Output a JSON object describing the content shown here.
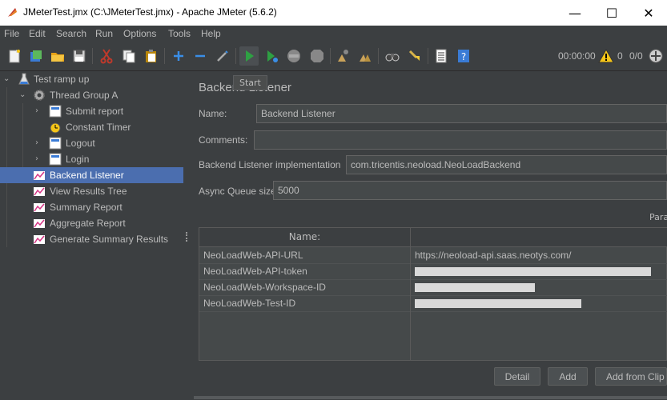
{
  "window": {
    "title": "JMeterTest.jmx (C:\\JMeterTest.jmx) - Apache JMeter (5.6.2)",
    "minimize": "—",
    "maximize": "☐",
    "close": "✕"
  },
  "menu": [
    "File",
    "Edit",
    "Search",
    "Run",
    "Options",
    "Tools",
    "Help"
  ],
  "toolbar": {
    "tooltip": "Start",
    "elapsed": "00:00:00",
    "errors": "0",
    "threads": "0/0"
  },
  "tree": [
    {
      "label": "Test ramp up",
      "icon": "test-plan-icon"
    },
    {
      "label": "Thread Group A",
      "icon": "gear-icon"
    },
    {
      "label": "Submit report",
      "icon": "sampler-icon"
    },
    {
      "label": "Constant Timer",
      "icon": "timer-icon"
    },
    {
      "label": "Logout",
      "icon": "sampler-icon"
    },
    {
      "label": "Login",
      "icon": "sampler-icon"
    },
    {
      "label": "Backend Listener",
      "icon": "listener-icon"
    },
    {
      "label": "View Results Tree",
      "icon": "listener-icon"
    },
    {
      "label": "Summary Report",
      "icon": "listener-icon"
    },
    {
      "label": "Aggregate Report",
      "icon": "listener-icon"
    },
    {
      "label": "Generate Summary Results",
      "icon": "listener-icon"
    }
  ],
  "panel": {
    "title": "Backend Listener",
    "name_label": "Name:",
    "name_value": "Backend Listener",
    "comments_label": "Comments:",
    "comments_value": "",
    "impl_label": "Backend Listener implementation",
    "impl_value": "com.tricentis.neoload.NeoLoadBackend",
    "queue_label": "Async Queue size",
    "queue_value": "5000",
    "params_label": "Para",
    "table": {
      "headers": [
        "Name:",
        ""
      ],
      "rows": [
        {
          "name": "NeoLoadWeb-API-URL",
          "value": "https://neoload-api.saas.neotys.com/"
        },
        {
          "name": "NeoLoadWeb-API-token",
          "value": ""
        },
        {
          "name": "NeoLoadWeb-Workspace-ID",
          "value": ""
        },
        {
          "name": "NeoLoadWeb-Test-ID",
          "value": ""
        }
      ]
    },
    "buttons": {
      "detail": "Detail",
      "add": "Add",
      "add_clipboard": "Add from Clip"
    }
  }
}
